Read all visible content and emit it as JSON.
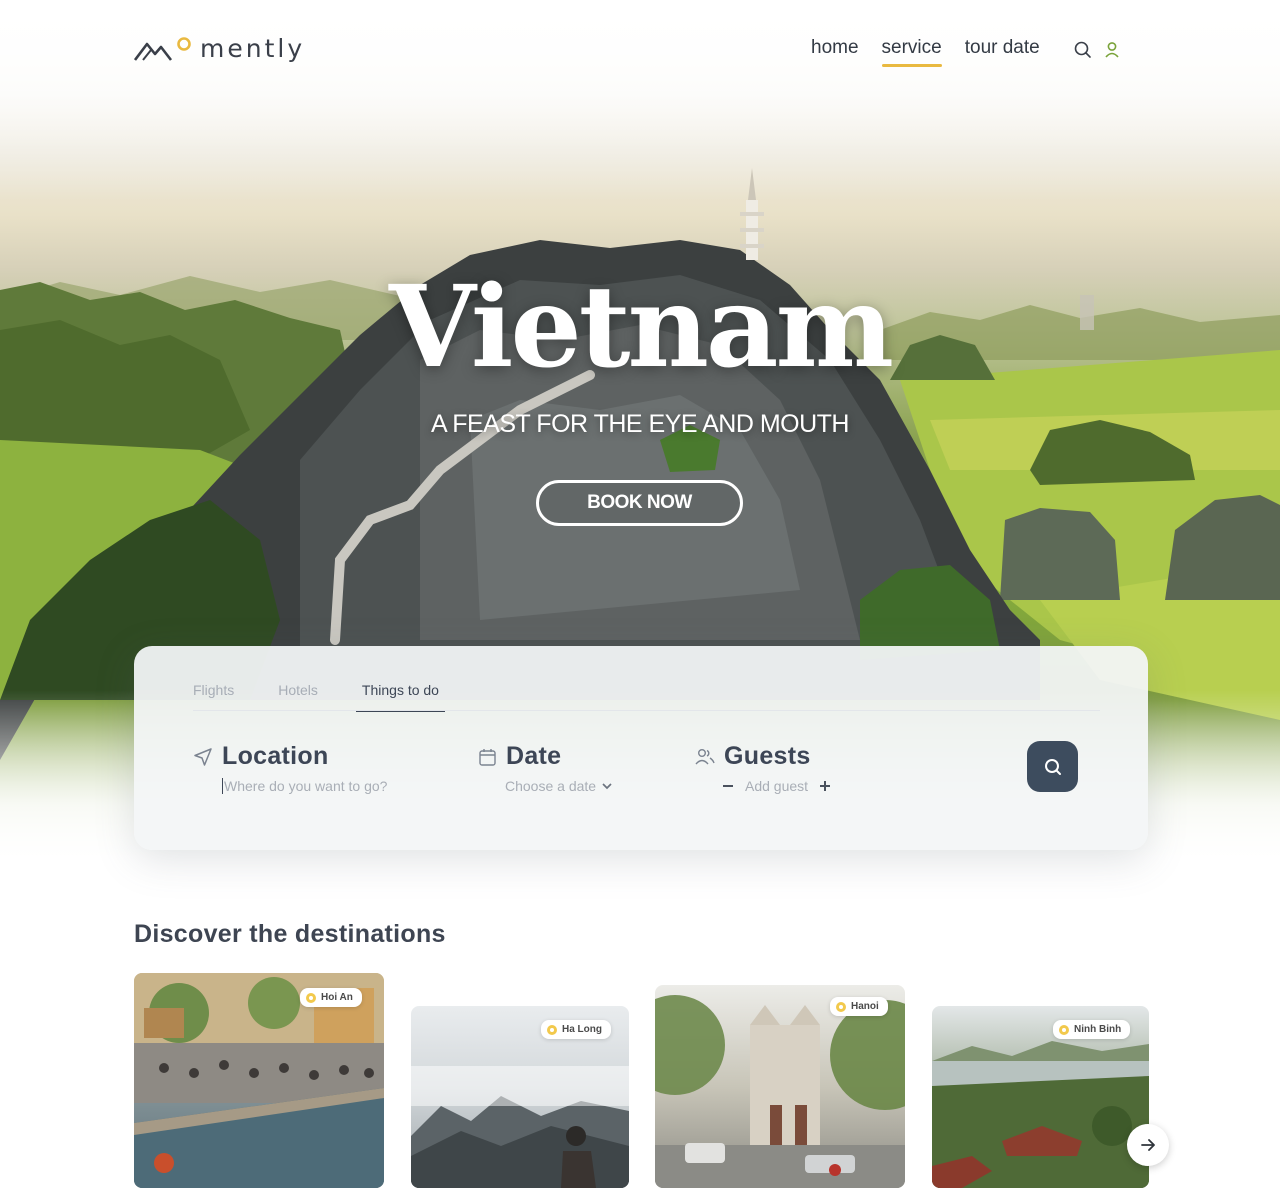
{
  "brand": {
    "name": "mently"
  },
  "nav": {
    "items": [
      {
        "label": "home"
      },
      {
        "label": "service",
        "active": true
      },
      {
        "label": "tour date"
      }
    ],
    "icons": [
      "search-icon",
      "user-icon"
    ],
    "accent_color": "#e9b940"
  },
  "hero": {
    "title": "Vietnam",
    "subtitle": "A FEAST FOR THE EYE AND MOUTH",
    "cta_label": "BOOK NOW"
  },
  "search": {
    "tabs": [
      {
        "label": "Flights"
      },
      {
        "label": "Hotels"
      },
      {
        "label": "Things to do",
        "active": true
      }
    ],
    "location": {
      "label": "Location",
      "placeholder": "Where do you want to go?",
      "icon": "send-icon"
    },
    "date": {
      "label": "Date",
      "value": "Choose a date",
      "icon": "calendar-icon"
    },
    "guests": {
      "label": "Guests",
      "value": "Add guest",
      "icon": "users-icon"
    },
    "button_icon": "search-icon",
    "button_color": "#3d4c5e"
  },
  "discover": {
    "title": "Discover the destinations",
    "cards": [
      {
        "name": "Hoi An"
      },
      {
        "name": "Ha Long"
      },
      {
        "name": "Hanoi"
      },
      {
        "name": "Ninh Binh"
      }
    ],
    "next_icon": "arrow-right-icon"
  }
}
